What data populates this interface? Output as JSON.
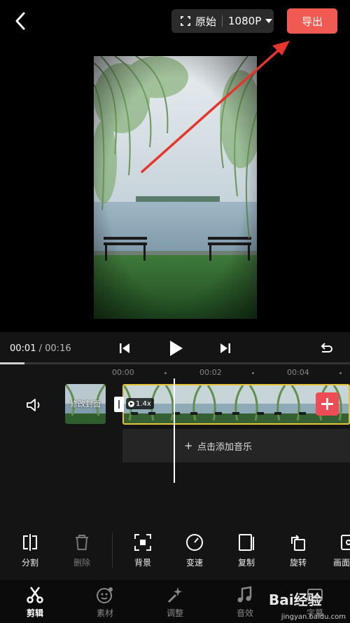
{
  "header": {
    "resolution_left": "原始",
    "resolution_right": "1080P",
    "export_label": "导出"
  },
  "player": {
    "current_time": "00:01",
    "separator": "/",
    "total_time": "00:16",
    "progress_fraction": 0.07
  },
  "timeline": {
    "ruler": [
      "00:00",
      "00:02",
      "00:04"
    ],
    "cover_label": "修改封面",
    "speed": "1.4x",
    "add_music_label": "点击添加音乐"
  },
  "toolbar": {
    "items": [
      {
        "label": "分割",
        "icon": "split-icon",
        "enabled": true
      },
      {
        "label": "删除",
        "icon": "trash-icon",
        "enabled": false
      },
      {
        "label": "背景",
        "icon": "background-icon",
        "enabled": true
      },
      {
        "label": "变速",
        "icon": "speed-icon",
        "enabled": true
      },
      {
        "label": "复制",
        "icon": "copy-icon",
        "enabled": true
      },
      {
        "label": "旋转",
        "icon": "rotate-icon",
        "enabled": true
      },
      {
        "label": "画面",
        "icon": "canvas-icon",
        "enabled": true
      }
    ]
  },
  "nav": {
    "items": [
      {
        "label": "剪辑",
        "icon": "scissors-icon",
        "active": true
      },
      {
        "label": "素材",
        "icon": "sticker-icon",
        "active": false
      },
      {
        "label": "调整",
        "icon": "magic-wand-icon",
        "active": false
      },
      {
        "label": "音效",
        "icon": "music-note-icon",
        "active": false
      },
      {
        "label": "字幕",
        "icon": "subtitle-icon",
        "active": false
      }
    ]
  },
  "watermark": {
    "logo_text": "Bai经验",
    "site": "jingyan.baidu.com"
  },
  "colors": {
    "accent": "#f05a52",
    "clip_border": "#e8c43a",
    "add_button": "#ef4b55"
  }
}
